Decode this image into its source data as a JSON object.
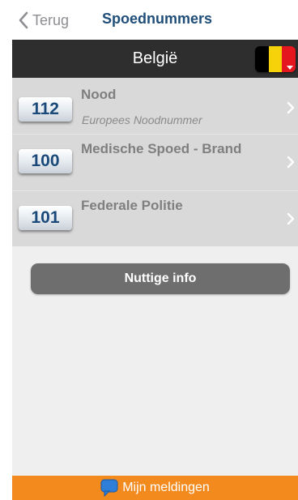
{
  "nav": {
    "back_label": "Terug",
    "title": "Spoednummers"
  },
  "country": {
    "name": "België",
    "flag_colors": [
      "#000000",
      "#f6d20a",
      "#e4171f"
    ]
  },
  "emergency_numbers": [
    {
      "number": "112",
      "title": "Nood",
      "subtitle": "Europees Noodnummer"
    },
    {
      "number": "100",
      "title": "Medische Spoed - Brand",
      "subtitle": ""
    },
    {
      "number": "101",
      "title": "Federale Politie",
      "subtitle": ""
    }
  ],
  "info_button": {
    "label": "Nuttige info"
  },
  "bottom_bar": {
    "label": "Mijn meldingen",
    "icon": "message-bubble-icon"
  },
  "colors": {
    "nav_title": "#1f4e79",
    "country_bar": "#2e2e2e",
    "bottom_bar": "#f28a1e",
    "button": "#6e6e6e"
  }
}
